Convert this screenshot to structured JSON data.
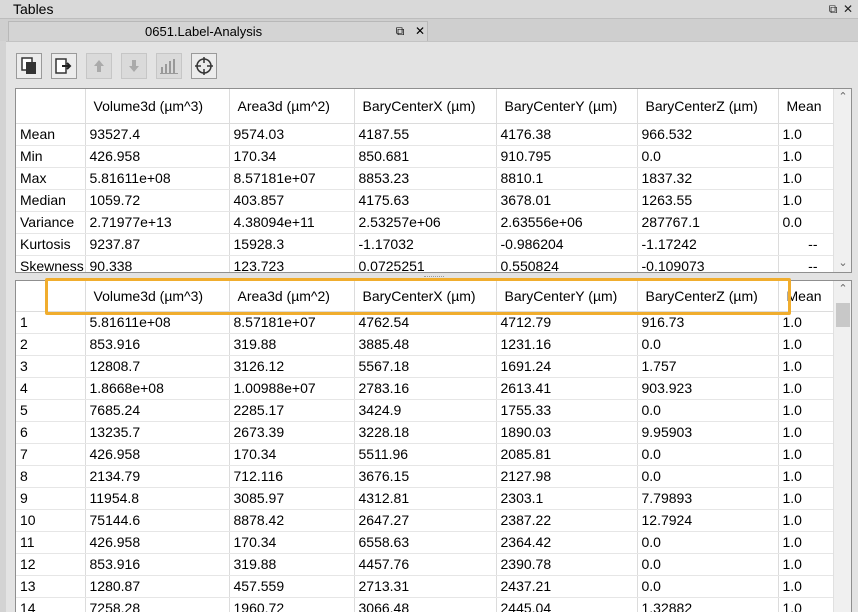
{
  "window": {
    "title": "Tables"
  },
  "tab": {
    "label": "0651.Label-Analysis"
  },
  "toolbar": {
    "buttons": [
      "copy-icon",
      "export-icon",
      "move-up-icon",
      "move-down-icon",
      "histogram-icon",
      "target-icon"
    ]
  },
  "columns": [
    "",
    "Volume3d (µm^3)",
    "Area3d (µm^2)",
    "BaryCenterX (µm)",
    "BaryCenterY (µm)",
    "BaryCenterZ (µm)",
    "Mean"
  ],
  "stats": [
    [
      "Mean",
      "93527.4",
      "9574.03",
      "4187.55",
      "4176.38",
      "966.532",
      "1.0"
    ],
    [
      "Min",
      "426.958",
      "170.34",
      "850.681",
      "910.795",
      "0.0",
      "1.0"
    ],
    [
      "Max",
      "5.81611e+08",
      "8.57181e+07",
      "8853.23",
      "8810.1",
      "1837.32",
      "1.0"
    ],
    [
      "Median",
      "1059.72",
      "403.857",
      "4175.63",
      "3678.01",
      "1263.55",
      "1.0"
    ],
    [
      "Variance",
      "2.71977e+13",
      "4.38094e+11",
      "2.53257e+06",
      "2.63556e+06",
      "287767.1",
      "0.0"
    ],
    [
      "Kurtosis",
      "9237.87",
      "15928.3",
      "-1.17032",
      "-0.986204",
      "-1.17242",
      "--"
    ],
    [
      "Skewness",
      "90.338",
      "123.723",
      "0.0725251",
      "0.550824",
      "-0.109073",
      "--"
    ]
  ],
  "rows": [
    [
      "1",
      "5.81611e+08",
      "8.57181e+07",
      "4762.54",
      "4712.79",
      "916.73",
      "1.0"
    ],
    [
      "2",
      "853.916",
      "319.88",
      "3885.48",
      "1231.16",
      "0.0",
      "1.0"
    ],
    [
      "3",
      "12808.7",
      "3126.12",
      "5567.18",
      "1691.24",
      "1.757",
      "1.0"
    ],
    [
      "4",
      "1.8668e+08",
      "1.00988e+07",
      "2783.16",
      "2613.41",
      "903.923",
      "1.0"
    ],
    [
      "5",
      "7685.24",
      "2285.17",
      "3424.9",
      "1755.33",
      "0.0",
      "1.0"
    ],
    [
      "6",
      "13235.7",
      "2673.39",
      "3228.18",
      "1890.03",
      "9.95903",
      "1.0"
    ],
    [
      "7",
      "426.958",
      "170.34",
      "5511.96",
      "2085.81",
      "0.0",
      "1.0"
    ],
    [
      "8",
      "2134.79",
      "712.116",
      "3676.15",
      "2127.98",
      "0.0",
      "1.0"
    ],
    [
      "9",
      "11954.8",
      "3085.97",
      "4312.81",
      "2303.1",
      "7.79893",
      "1.0"
    ],
    [
      "10",
      "75144.6",
      "8878.42",
      "2647.27",
      "2387.22",
      "12.7924",
      "1.0"
    ],
    [
      "11",
      "426.958",
      "170.34",
      "6558.63",
      "2364.42",
      "0.0",
      "1.0"
    ],
    [
      "12",
      "853.916",
      "319.88",
      "4457.76",
      "2390.78",
      "0.0",
      "1.0"
    ],
    [
      "13",
      "1280.87",
      "457.559",
      "2713.31",
      "2437.21",
      "0.0",
      "1.0"
    ],
    [
      "14",
      "7258.28",
      "1960.72",
      "3066.48",
      "2445.04",
      "1.32882",
      "1.0"
    ]
  ],
  "colors": {
    "highlight": "#f0ad2e"
  }
}
